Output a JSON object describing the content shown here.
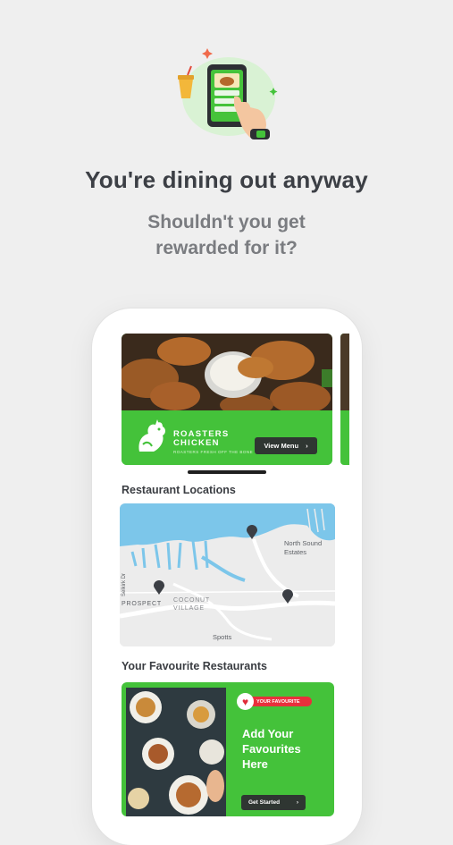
{
  "onboarding": {
    "headline": "You're dining out anyway",
    "subheadline": "Shouldn't you get\nrewarded for it?"
  },
  "featured_restaurant": {
    "name_line1": "ROASTERS",
    "name_line2": "CHICKEN",
    "tagline": "ROASTERS FRESH OFF THE BONE",
    "menu_button_label": "View Menu",
    "menu_button_icon": "chevron-right-icon"
  },
  "locations": {
    "section_title": "Restaurant Locations",
    "map_labels": {
      "north_sound_estates": "North Sound\nEstates",
      "prospect": "PROSPECT",
      "coconut_village": "COCONUT\nVILLAGE",
      "spotts": "Spotts",
      "selkirk_dr": "Selkirk Dr"
    },
    "pins": [
      "1",
      "2",
      "3"
    ]
  },
  "favourites": {
    "section_title": "Your Favourite Restaurants",
    "badge_label": "YOUR FAVOURITE",
    "heading": "Add Your\nFavourites\nHere",
    "cta_label": "Get Started",
    "cta_icon": "chevron-right-icon"
  },
  "colors": {
    "brand_green": "#44c23a",
    "background": "#efefef",
    "heading_text": "#3c3f45",
    "subheading_text": "#7a7c80",
    "button_dark": "#2f3632",
    "badge_red": "#e8303c"
  }
}
